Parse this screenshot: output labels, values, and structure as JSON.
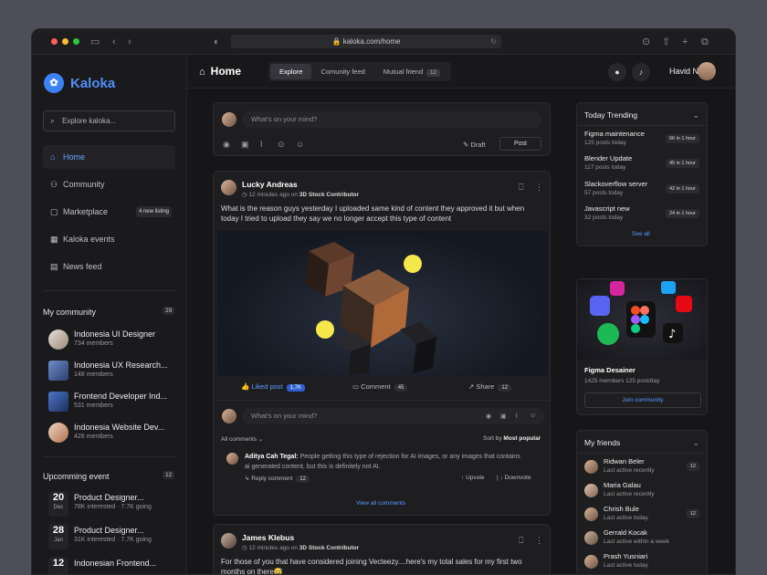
{
  "browser": {
    "url": "kaloka.com/home"
  },
  "brand": {
    "name": "Kaloka",
    "accent": "#3b82f6"
  },
  "sidebar": {
    "search_placeholder": "Explore kaloka...",
    "nav": [
      {
        "label": "Home",
        "icon": "home-icon"
      },
      {
        "label": "Community",
        "icon": "community-icon"
      },
      {
        "label": "Marketplace",
        "icon": "marketplace-icon",
        "badge": "4 new listing"
      },
      {
        "label": "Kaloka events",
        "icon": "calendar-icon"
      },
      {
        "label": "News feed",
        "icon": "news-icon"
      }
    ],
    "my_community": {
      "title": "My community",
      "count": "29",
      "items": [
        {
          "name": "Indonesia UI Designer",
          "members": "734 members"
        },
        {
          "name": "Indonesia UX Research...",
          "members": "148 members"
        },
        {
          "name": "Frontend Developer Ind...",
          "members": "531 members"
        },
        {
          "name": "Indonesia Website Dev...",
          "members": "426 members"
        }
      ]
    },
    "events": {
      "title": "Upcomming event",
      "count": "12",
      "items": [
        {
          "day": "20",
          "month": "Dec",
          "title": "Product Designer...",
          "info": "78K interested · 7.7K going"
        },
        {
          "day": "28",
          "month": "Jan",
          "title": "Product Designer...",
          "info": "31K interested · 7.7K going"
        },
        {
          "day": "12",
          "month": "",
          "title": "Indonesian Frontend...",
          "info": ""
        }
      ]
    }
  },
  "header": {
    "title": "Home",
    "tabs": [
      {
        "label": "Explore"
      },
      {
        "label": "Comunity feed"
      },
      {
        "label": "Mutual friend",
        "count": "12"
      }
    ],
    "user_name": "Havid N"
  },
  "composer": {
    "placeholder": "What's on your mind?",
    "draft_label": "Draft",
    "post_label": "Post"
  },
  "post1": {
    "author": "Lucky Andreas",
    "time": "12 minutes ago on",
    "group": "3D Stock Contributor",
    "text1": "What is the reason guys yesterday I uploaded same kind of content they approved it but when",
    "text2": "today I tried to upload they say we no longer accept this type of content",
    "liked_label": "Liked post",
    "likes": "1,7K",
    "comment_label": "Comment",
    "comments": "45",
    "share_label": "Share",
    "shares": "12",
    "comment_placeholder": "What's on your mind?",
    "filter_label": "All comments",
    "sort_prefix": "Sort by",
    "sort_value": "Most popular",
    "comment": {
      "author": "Aditya Cah Tegal:",
      "text1": "People getting this type of rejection for AI images, or any images that contains",
      "text2": "ai generated content, but this is definitely not AI.",
      "reply_label": "Reply comment",
      "reply_count": "12",
      "upvote": "Upvote",
      "downvote": "Downvote"
    },
    "view_all": "View all comments"
  },
  "post2": {
    "author": "James Klebus",
    "time": "12 minutes ago on",
    "group": "3D Stock Contributor",
    "text1": "For those of you that have considered joining Vecteezy....here's my total sales for my first two",
    "text2": "months on there😅"
  },
  "trending": {
    "title": "Today Trending",
    "items": [
      {
        "name": "Figma maintenance",
        "posts": "125 posts today",
        "time": "66 in 1 hour"
      },
      {
        "name": "Blender Update",
        "posts": "117 posts today",
        "time": "45 in 1 hour"
      },
      {
        "name": "Slackoverflow server",
        "posts": "57 posts today",
        "time": "42 in 1 hour"
      },
      {
        "name": "Javascript new",
        "posts": "32 posts today",
        "time": "24 in 1 hour"
      }
    ],
    "see_all": "See all"
  },
  "promo": {
    "name": "Figma Desainer",
    "meta": "1425 members  125 post/day",
    "join": "Join community"
  },
  "friends": {
    "title": "My friends",
    "items": [
      {
        "name": "Ridwan Beler",
        "status": "Last active recently",
        "badge": "12"
      },
      {
        "name": "Maria Galau",
        "status": "Last active recently",
        "badge": ""
      },
      {
        "name": "Chrish Bule",
        "status": "Last active today",
        "badge": "12"
      },
      {
        "name": "Gerrald Kocak",
        "status": "Last active within a week",
        "badge": ""
      },
      {
        "name": "Prash Yusniari",
        "status": "Last active today",
        "badge": ""
      }
    ]
  }
}
